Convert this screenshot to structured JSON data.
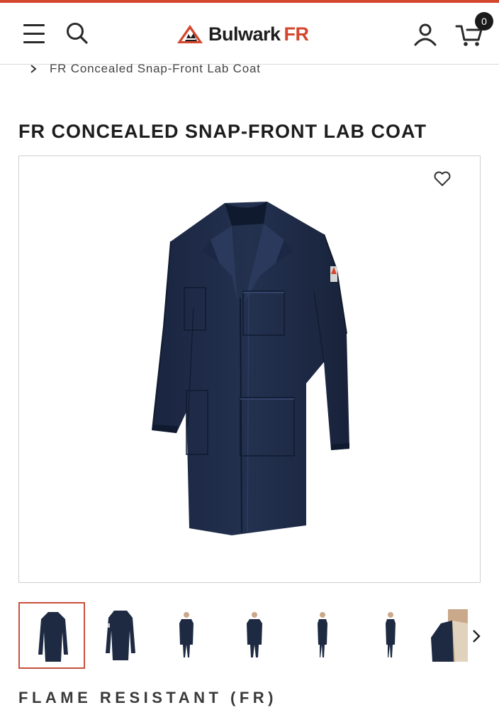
{
  "header": {
    "brand_name": "Bulwark",
    "brand_suffix": "FR",
    "cart_count": "0",
    "icons": [
      "menu-icon",
      "search-icon",
      "account-icon",
      "cart-icon"
    ]
  },
  "breadcrumb": {
    "current": "FR Concealed Snap-Front Lab Coat"
  },
  "product": {
    "title": "FR CONCEALED SNAP-FRONT LAB COAT",
    "thumbnail_count": 7,
    "selected_thumbnail": 1
  },
  "section": {
    "label": "FLAME RESISTANT (FR)"
  },
  "colors": {
    "accent": "#d4462d",
    "coat_navy": "#1d2a42",
    "border": "#cfcfcf"
  }
}
